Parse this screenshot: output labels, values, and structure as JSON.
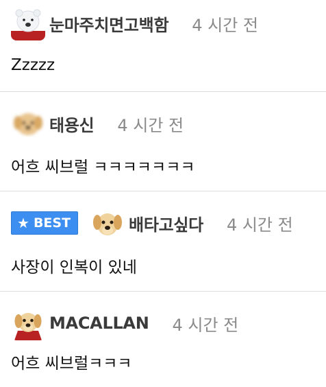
{
  "comments": [
    {
      "nickname": "눈마주치면고백함",
      "time": "4 시간 전",
      "text": "Zzzzz",
      "avatar_icon": "polar-bear-avatar-icon",
      "best": false
    },
    {
      "nickname": "태용신",
      "time": "4 시간 전",
      "text": "어흐 씨브럴 ㅋㅋㅋㅋㅋㅋㅋ",
      "avatar_icon": "puppy-blurred-avatar-icon",
      "best": false
    },
    {
      "nickname": "배타고싶다",
      "time": "4 시간 전",
      "text": "사장이 인복이 있네",
      "avatar_icon": "puppy-avatar-icon",
      "best": true,
      "best_label": "BEST",
      "best_icon": "star-icon"
    },
    {
      "nickname": "MACALLAN",
      "time": "4 시간 전",
      "text": "어흐 씨브럴ㅋㅋㅋ",
      "avatar_icon": "puppy-red-shirt-avatar-icon",
      "best": false
    }
  ],
  "colors": {
    "best_badge": "#3c8ef0",
    "nickname": "#3a3a3a",
    "time": "#8a8a8a",
    "divider": "#dcdcdc"
  }
}
